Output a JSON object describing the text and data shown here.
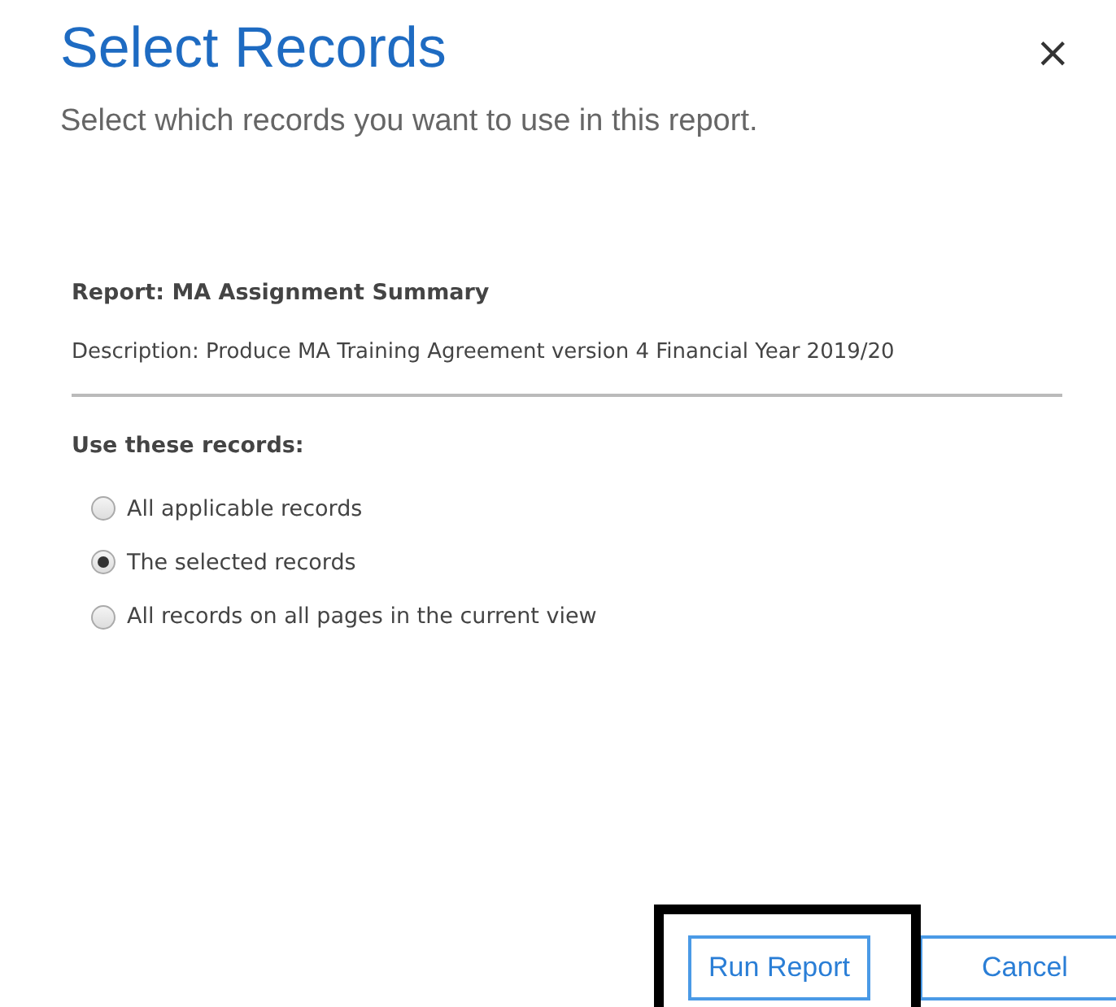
{
  "dialog": {
    "title": "Select Records",
    "subtitle": "Select which records you want to use in this report."
  },
  "report": {
    "name": "Report: MA Assignment Summary",
    "description": "Description: Produce MA Training Agreement version 4 Financial Year 2019/20"
  },
  "records_label": "Use these records:",
  "options": [
    {
      "label": "All applicable records",
      "selected": false
    },
    {
      "label": "The selected records",
      "selected": true
    },
    {
      "label": "All records on all pages in the current view",
      "selected": false
    }
  ],
  "buttons": [
    {
      "label": "Run Report",
      "highlighted": true
    },
    {
      "label": "Cancel",
      "highlighted": false
    }
  ],
  "close_glyph": "×"
}
